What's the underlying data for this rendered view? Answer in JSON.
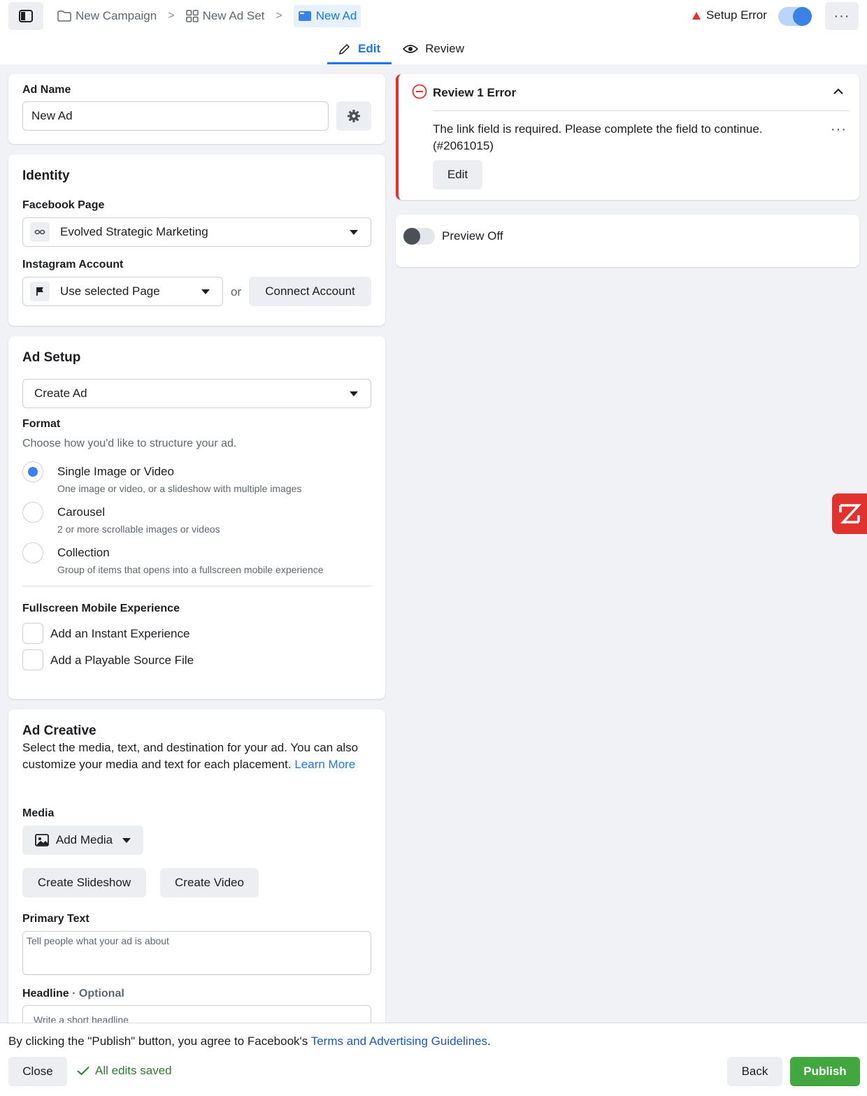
{
  "breadcrumb": {
    "campaign": "New Campaign",
    "adset": "New Ad Set",
    "ad": "New Ad"
  },
  "status": {
    "setup_error": "Setup Error",
    "accent": "#1877f2",
    "error_color": "#e0322f"
  },
  "tabs": [
    {
      "label": "Edit",
      "active": true
    },
    {
      "label": "Review",
      "active": false
    }
  ],
  "ad_name": {
    "label": "Ad Name",
    "value": "New Ad"
  },
  "identity": {
    "heading": "Identity",
    "facebook_page_label": "Facebook Page",
    "facebook_page_value": "Evolved Strategic Marketing",
    "instagram_label": "Instagram Account",
    "instagram_value": "Use selected Page",
    "or_text": "or",
    "connect_button": "Connect Account"
  },
  "ad_setup": {
    "heading": "Ad Setup",
    "setup_select": "Create Ad",
    "format_label": "Format",
    "format_hint": "Choose how you'd like to structure your ad.",
    "formats": [
      {
        "title": "Single Image or Video",
        "desc": "One image or video, or a slideshow with multiple images",
        "checked": true
      },
      {
        "title": "Carousel",
        "desc": "2 or more scrollable images or videos",
        "checked": false
      },
      {
        "title": "Collection",
        "desc": "Group of items that opens into a fullscreen mobile experience",
        "checked": false
      }
    ],
    "fullscreen_label": "Fullscreen Mobile Experience",
    "checkboxes": [
      "Add an Instant Experience",
      "Add a Playable Source File"
    ]
  },
  "ad_creative": {
    "heading": "Ad Creative",
    "description": "Select the media, text, and destination for your ad. You can also customize your media and text for each placement.",
    "learn_more": "Learn More",
    "media_label": "Media",
    "add_media": "Add Media",
    "create_slideshow": "Create Slideshow",
    "create_video": "Create Video",
    "primary_text_label": "Primary Text",
    "primary_text_placeholder": "Tell people what your ad is about",
    "headline_label": "Headline",
    "headline_optional": "· Optional",
    "headline_placeholder": "Write a short headline"
  },
  "review": {
    "title": "Review 1 Error",
    "message": "The link field is required. Please complete the field to continue.",
    "code": "(#2061015)",
    "edit_button": "Edit"
  },
  "preview": {
    "label": "Preview Off"
  },
  "footer": {
    "terms_prefix": "By clicking the \"Publish\" button, you agree to Facebook's ",
    "terms_link": "Terms and Advertising Guidelines",
    "terms_suffix": ".",
    "close": "Close",
    "saved": "All edits saved",
    "back": "Back",
    "publish": "Publish"
  }
}
